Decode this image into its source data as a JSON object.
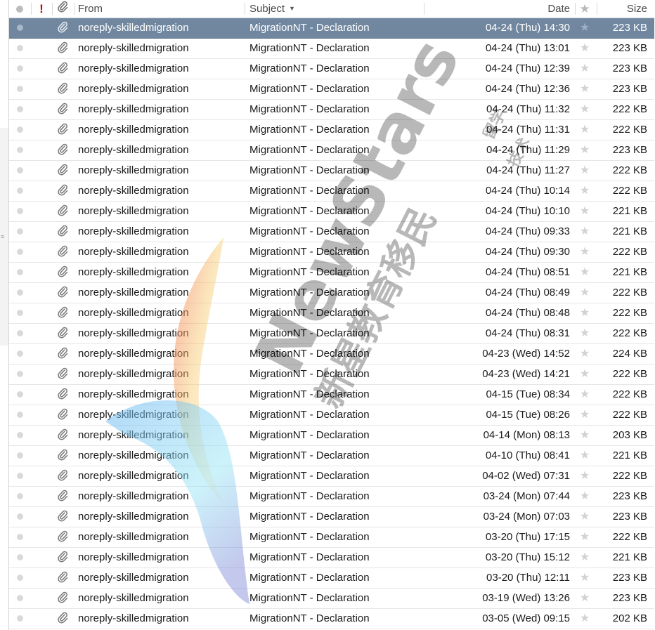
{
  "header": {
    "from": "From",
    "subject": "Subject",
    "date": "Date",
    "size": "Size",
    "importance_glyph": "!"
  },
  "icons": {
    "read_status": "dot-icon",
    "attachment": "paperclip-icon",
    "star": "star-icon",
    "sort": "chevron-down-icon"
  },
  "colors": {
    "selected_row": "#71879f",
    "importance": "#d00000"
  },
  "messages": [
    {
      "from": "noreply-skilledmigration",
      "subject": "MigrationNT - Declaration",
      "date": "04-24 (Thu) 14:30",
      "size": "223 KB",
      "selected": true
    },
    {
      "from": "noreply-skilledmigration",
      "subject": "MigrationNT - Declaration",
      "date": "04-24 (Thu) 13:01",
      "size": "223 KB"
    },
    {
      "from": "noreply-skilledmigration",
      "subject": "MigrationNT - Declaration",
      "date": "04-24 (Thu) 12:39",
      "size": "223 KB"
    },
    {
      "from": "noreply-skilledmigration",
      "subject": "MigrationNT - Declaration",
      "date": "04-24 (Thu) 12:36",
      "size": "223 KB"
    },
    {
      "from": "noreply-skilledmigration",
      "subject": "MigrationNT - Declaration",
      "date": "04-24 (Thu) 11:32",
      "size": "222 KB"
    },
    {
      "from": "noreply-skilledmigration",
      "subject": "MigrationNT - Declaration",
      "date": "04-24 (Thu) 11:31",
      "size": "222 KB"
    },
    {
      "from": "noreply-skilledmigration",
      "subject": "MigrationNT - Declaration",
      "date": "04-24 (Thu) 11:29",
      "size": "223 KB"
    },
    {
      "from": "noreply-skilledmigration",
      "subject": "MigrationNT - Declaration",
      "date": "04-24 (Thu) 11:27",
      "size": "222 KB"
    },
    {
      "from": "noreply-skilledmigration",
      "subject": "MigrationNT - Declaration",
      "date": "04-24 (Thu) 10:14",
      "size": "222 KB"
    },
    {
      "from": "noreply-skilledmigration",
      "subject": "MigrationNT - Declaration",
      "date": "04-24 (Thu) 10:10",
      "size": "221 KB"
    },
    {
      "from": "noreply-skilledmigration",
      "subject": "MigrationNT - Declaration",
      "date": "04-24 (Thu) 09:33",
      "size": "221 KB"
    },
    {
      "from": "noreply-skilledmigration",
      "subject": "MigrationNT - Declaration",
      "date": "04-24 (Thu) 09:30",
      "size": "222 KB"
    },
    {
      "from": "noreply-skilledmigration",
      "subject": "MigrationNT - Declaration",
      "date": "04-24 (Thu) 08:51",
      "size": "221 KB"
    },
    {
      "from": "noreply-skilledmigration",
      "subject": "MigrationNT - Declaration",
      "date": "04-24 (Thu) 08:49",
      "size": "222 KB"
    },
    {
      "from": "noreply-skilledmigration",
      "subject": "MigrationNT - Declaration",
      "date": "04-24 (Thu) 08:48",
      "size": "222 KB"
    },
    {
      "from": "noreply-skilledmigration",
      "subject": "MigrationNT - Declaration",
      "date": "04-24 (Thu) 08:31",
      "size": "222 KB"
    },
    {
      "from": "noreply-skilledmigration",
      "subject": "MigrationNT - Declaration",
      "date": "04-23 (Wed) 14:52",
      "size": "224 KB"
    },
    {
      "from": "noreply-skilledmigration",
      "subject": "MigrationNT - Declaration",
      "date": "04-23 (Wed) 14:21",
      "size": "222 KB"
    },
    {
      "from": "noreply-skilledmigration",
      "subject": "MigrationNT - Declaration",
      "date": "04-15 (Tue) 08:34",
      "size": "222 KB"
    },
    {
      "from": "noreply-skilledmigration",
      "subject": "MigrationNT - Declaration",
      "date": "04-15 (Tue) 08:26",
      "size": "222 KB"
    },
    {
      "from": "noreply-skilledmigration",
      "subject": "MigrationNT - Declaration",
      "date": "04-14 (Mon) 08:13",
      "size": "203 KB"
    },
    {
      "from": "noreply-skilledmigration",
      "subject": "MigrationNT - Declaration",
      "date": "04-10 (Thu) 08:41",
      "size": "221 KB"
    },
    {
      "from": "noreply-skilledmigration",
      "subject": "MigrationNT - Declaration",
      "date": "04-02 (Wed) 07:31",
      "size": "222 KB"
    },
    {
      "from": "noreply-skilledmigration",
      "subject": "MigrationNT - Declaration",
      "date": "03-24 (Mon) 07:44",
      "size": "223 KB"
    },
    {
      "from": "noreply-skilledmigration",
      "subject": "MigrationNT - Declaration",
      "date": "03-24 (Mon) 07:03",
      "size": "223 KB"
    },
    {
      "from": "noreply-skilledmigration",
      "subject": "MigrationNT - Declaration",
      "date": "03-20 (Thu) 17:15",
      "size": "222 KB"
    },
    {
      "from": "noreply-skilledmigration",
      "subject": "MigrationNT - Declaration",
      "date": "03-20 (Thu) 15:12",
      "size": "221 KB"
    },
    {
      "from": "noreply-skilledmigration",
      "subject": "MigrationNT - Declaration",
      "date": "03-20 (Thu) 12:11",
      "size": "223 KB"
    },
    {
      "from": "noreply-skilledmigration",
      "subject": "MigrationNT - Declaration",
      "date": "03-19 (Wed) 13:26",
      "size": "223 KB"
    },
    {
      "from": "noreply-skilledmigration",
      "subject": "MigrationNT - Declaration",
      "date": "03-05 (Wed) 09:15",
      "size": "202 KB"
    }
  ],
  "watermark": {
    "brand": "NewStars",
    "chinese": "新星教育移民",
    "chinese_small": "留学",
    "chinese_small2": "技术"
  }
}
